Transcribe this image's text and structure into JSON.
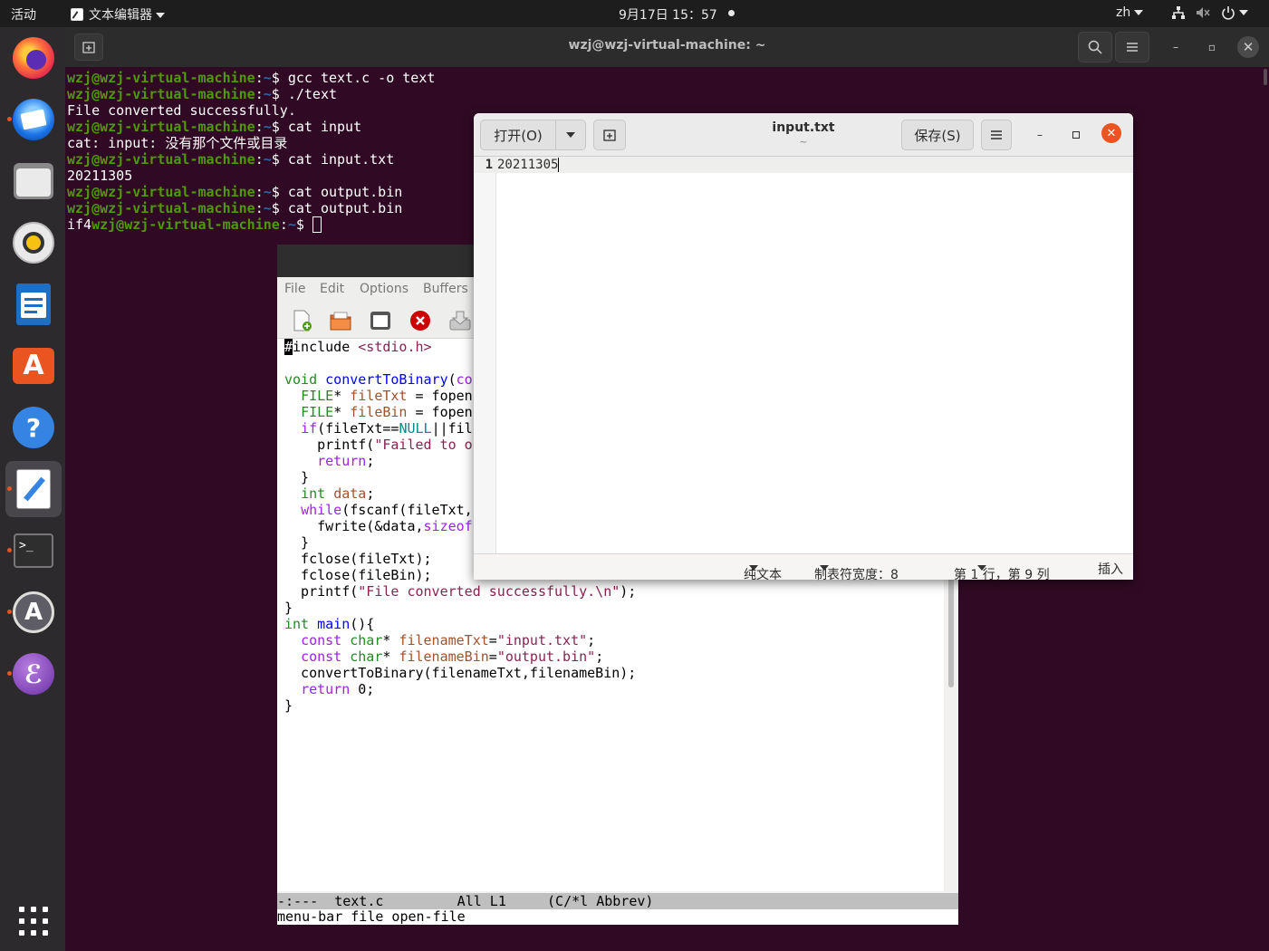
{
  "topbar": {
    "activities": "活动",
    "app_menu": "文本编辑器",
    "datetime": "9月17日 15：57",
    "input_method": "zh"
  },
  "dock": {
    "items": [
      "firefox",
      "thunderbird",
      "files",
      "rhythmbox",
      "libreoffice-writer",
      "ubuntu-software",
      "help",
      "text-editor",
      "terminal",
      "software-updater",
      "emacs"
    ],
    "show_apps": "show-applications"
  },
  "terminal": {
    "title": "wzj@wzj-virtual-machine: ~",
    "prompt_user": "wzj@wzj-virtual-machine",
    "prompt_path": "~",
    "lines": [
      {
        "type": "cmd",
        "text": "$ gcc text.c -o text"
      },
      {
        "type": "cmd",
        "text": "$ ./text"
      },
      {
        "type": "out",
        "text": "File converted successfully."
      },
      {
        "type": "cmd",
        "text": "$ cat input"
      },
      {
        "type": "out",
        "text": "cat: input: 没有那个文件或目录"
      },
      {
        "type": "cmd",
        "text": "$ cat input.txt"
      },
      {
        "type": "out",
        "text": "20211305"
      },
      {
        "type": "cmd",
        "text": "$ cat output.bin"
      },
      {
        "type": "cmd",
        "text": "$ cat output.bin"
      }
    ],
    "last_output_prefix": "if4",
    "last_prompt_suffix": "$ "
  },
  "emacs": {
    "menu": [
      "File",
      "Edit",
      "Options",
      "Buffers"
    ],
    "toolbar": [
      "new-file-icon",
      "open-folder-icon",
      "save-window-icon",
      "close-icon",
      "download-icon"
    ],
    "mode_line": "-:---  text.c         All L1     (C/*l Abbrev)",
    "minibuffer": "menu-bar file open-file"
  },
  "gedit": {
    "open_label": "打开(O)",
    "title": "input.txt",
    "subtitle": "~",
    "save_label": "保存(S)",
    "line_number": "1",
    "content": "20211305",
    "status": {
      "syntax": "纯文本",
      "tab_width": "制表符宽度：8",
      "position": "第 1 行，第 9 列",
      "mode": "插入"
    }
  }
}
